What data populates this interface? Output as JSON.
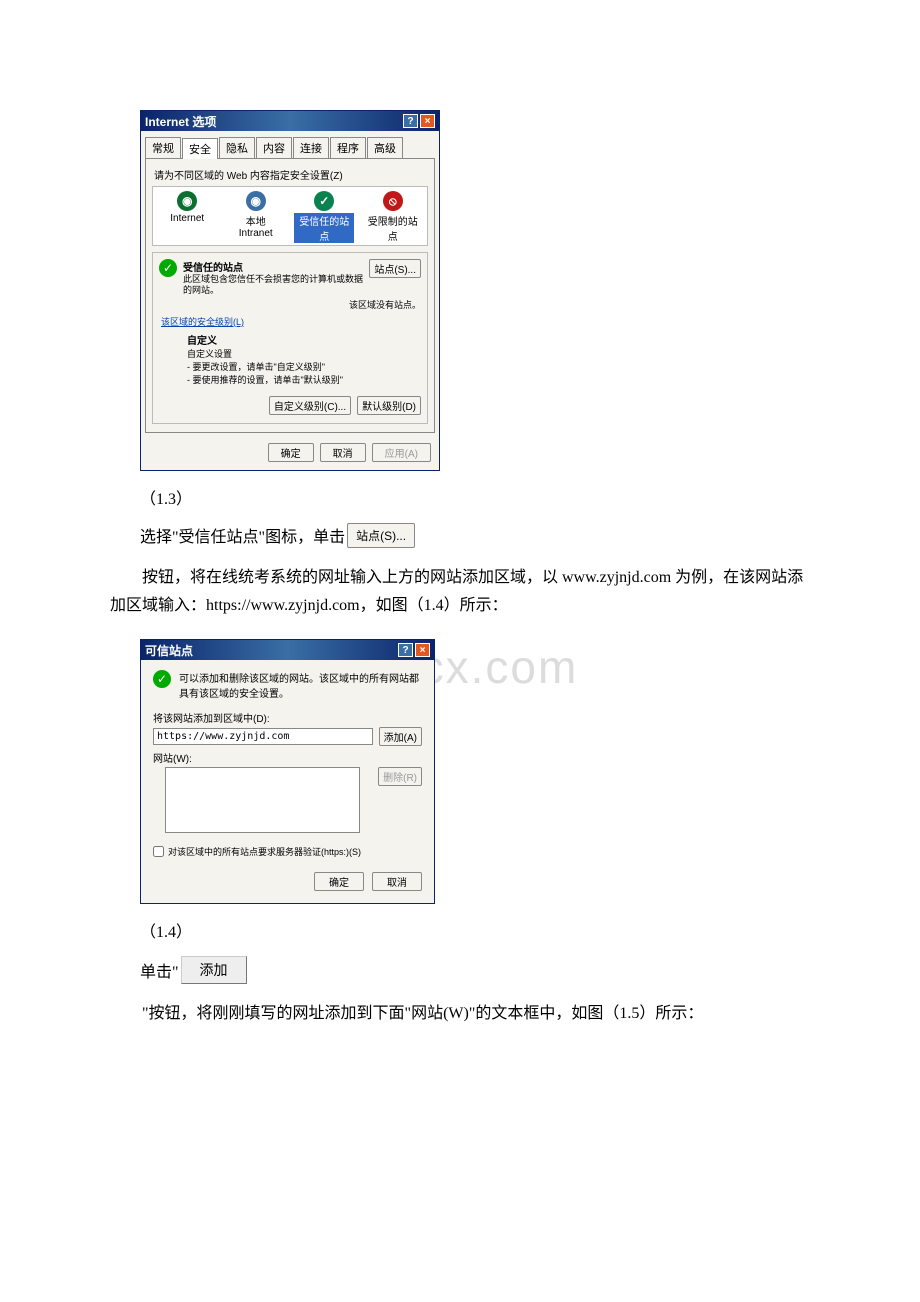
{
  "watermark": "www.bdocx.com",
  "dialog1": {
    "title": "Internet 选项",
    "help_symbol": "?",
    "close_symbol": "×",
    "tabs": [
      "常规",
      "安全",
      "隐私",
      "内容",
      "连接",
      "程序",
      "高级"
    ],
    "instruction": "请为不同区域的 Web 内容指定安全设置(Z)",
    "zones": {
      "internet": "Internet",
      "intranet1": "本地",
      "intranet2": "Intranet",
      "trusted1": "受信任的站",
      "trusted2": "点",
      "restricted1": "受限制的站",
      "restricted2": "点"
    },
    "trusted_title": "受信任的站点",
    "trusted_desc": "此区域包含您信任不会损害您的计算机或数据的网站。",
    "sites_btn": "站点(S)...",
    "status": "该区域没有站点。",
    "sec_link": "该区域的安全级别(L)",
    "custom_title": "自定义",
    "custom_l1": "自定义设置",
    "custom_l2": "- 要更改设置，请单击\"自定义级别\"",
    "custom_l3": "- 要使用推荐的设置，请单击\"默认级别\"",
    "custom_btn": "自定义级别(C)...",
    "default_btn": "默认级别(D)",
    "ok": "确定",
    "cancel": "取消",
    "apply": "应用(A)"
  },
  "fig13": "（1.3）",
  "line1_a": "选择\"受信任站点\"图标，单击",
  "sites_inline_btn": "站点(S)...",
  "para2": "按钮，将在线统考系统的网址输入上方的网站添加区域，以 www.zyjnjd.com 为例，在该网站添加区域输入：https://www.zyjnjd.com，如图（1.4）所示：",
  "dialog2": {
    "title": "可信站点",
    "desc": "可以添加和删除该区域的网站。该区域中的所有网站都具有该区域的安全设置。",
    "add_label": "将该网站添加到区域中(D):",
    "input_value": "https://www.zyjnjd.com",
    "add_btn": "添加(A)",
    "sites_label": "网站(W):",
    "remove_btn": "删除(R)",
    "check_label": "对该区域中的所有站点要求服务器验证(https:)(S)",
    "ok": "确定",
    "cancel": "取消"
  },
  "fig14": "（1.4）",
  "line3_a": "单击\"",
  "add_inline_btn": "添加",
  "para4": "\"按钮，将刚刚填写的网址添加到下面\"网站(W)\"的文本框中，如图（1.5）所示："
}
